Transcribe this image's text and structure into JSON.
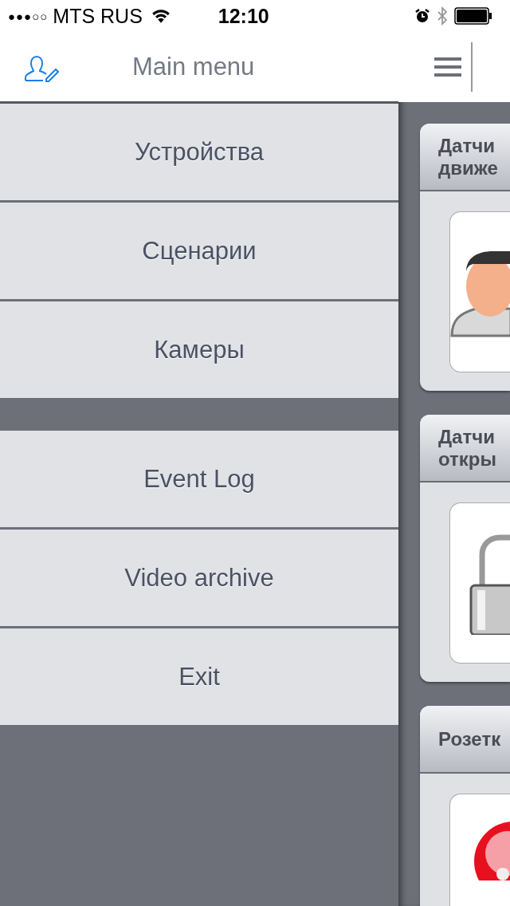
{
  "status_bar": {
    "signal": "●●●○○",
    "carrier": "MTS RUS",
    "time": "12:10"
  },
  "nav_bar": {
    "title": "Main menu"
  },
  "menu_groups": [
    [
      {
        "label": "Устройства"
      },
      {
        "label": "Сценарии"
      },
      {
        "label": "Камеры"
      }
    ],
    [
      {
        "label": "Event Log"
      },
      {
        "label": "Video archive"
      },
      {
        "label": "Exit"
      }
    ]
  ],
  "device_cards": [
    {
      "title_lines": [
        "Датчи",
        "движе"
      ],
      "kind": "person"
    },
    {
      "title_lines": [
        "Датчи",
        "откры"
      ],
      "kind": "lock"
    },
    {
      "title_lines": [
        "Розетк"
      ],
      "kind": "socket"
    }
  ]
}
